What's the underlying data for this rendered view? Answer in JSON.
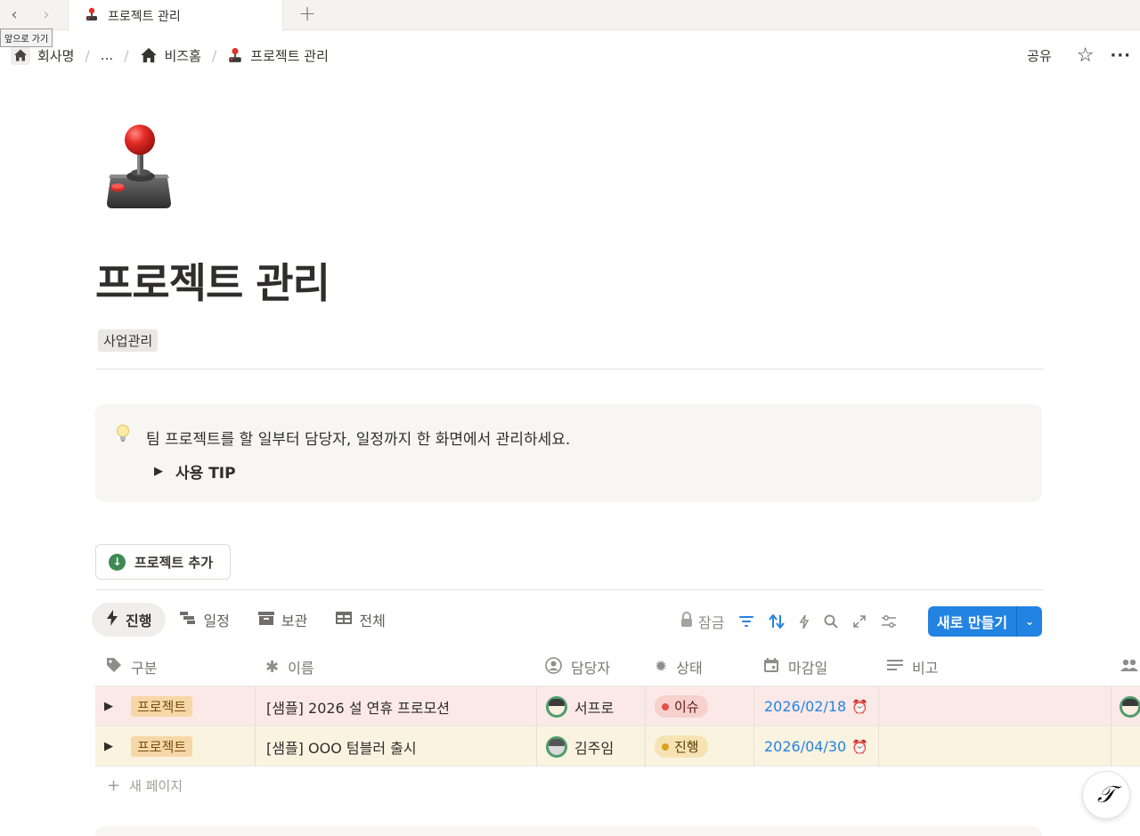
{
  "browser": {
    "tab_title": "프로젝트 관리",
    "tooltip": "앞으로 가기"
  },
  "breadcrumb": {
    "items": [
      "회사명",
      "...",
      "비즈홈",
      "프로젝트 관리"
    ]
  },
  "topbar": {
    "share_label": "공유"
  },
  "page": {
    "title": "프로젝트 관리",
    "tag": "사업관리"
  },
  "callout": {
    "text": "팀 프로젝트를 할 일부터 담당자, 일정까지 한 화면에서 관리하세요.",
    "toggle_label": "사용 TIP"
  },
  "add_button": {
    "label": "프로젝트 추가"
  },
  "views": [
    {
      "label": "진행",
      "icon": "lightning-icon",
      "active": true
    },
    {
      "label": "일정",
      "icon": "timeline-icon",
      "active": false
    },
    {
      "label": "보관",
      "icon": "archive-icon",
      "active": false
    },
    {
      "label": "전체",
      "icon": "table-icon",
      "active": false
    }
  ],
  "toolbar": {
    "lock_label": "잠금",
    "new_label": "새로 만들기"
  },
  "table": {
    "columns": [
      "구분",
      "이름",
      "담당자",
      "상태",
      "마감일",
      "비고"
    ],
    "rows": [
      {
        "type": "프로젝트",
        "name": "[샘플] 2026 설 연휴 프로모션",
        "owner": "서프로",
        "status": "이슈",
        "due": "2026/02/18"
      },
      {
        "type": "프로젝트",
        "name": "[샘플] OOO 텀블러 출시",
        "owner": "김주임",
        "status": "진행",
        "due": "2026/04/30"
      }
    ],
    "new_page_label": "새 페이지"
  },
  "colors": {
    "accent": "#2383e2",
    "issue_row": "#fbe9e7",
    "progress_row": "#faf3e0",
    "issue_status": "#e2504a",
    "progress_status": "#d9a21f"
  }
}
